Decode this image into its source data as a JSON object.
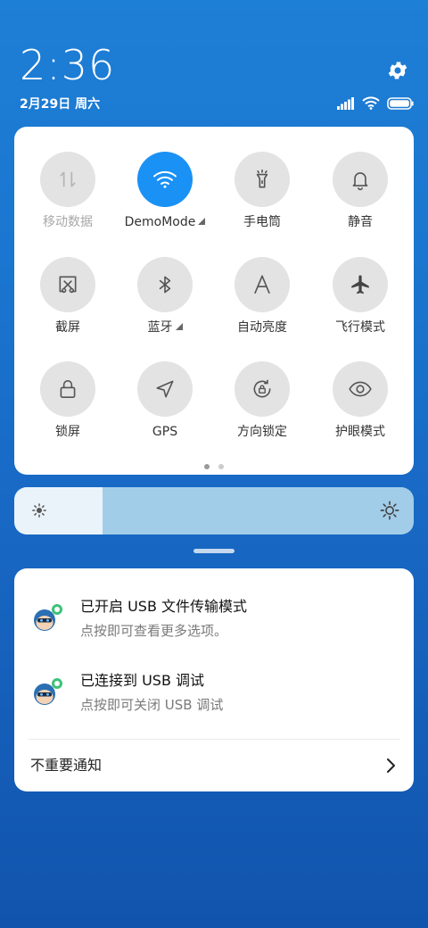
{
  "status_bar": {
    "time": "2:36",
    "date": "2月29日 周六",
    "icons": [
      "signal-icon",
      "wifi-icon",
      "battery-icon"
    ]
  },
  "quick_settings": {
    "tiles": [
      {
        "label": "移动数据",
        "icon": "mobile-data-icon",
        "active": false,
        "disabled": true
      },
      {
        "label": "DemoMode",
        "icon": "wifi-icon",
        "active": true,
        "disabled": false,
        "has_submenu": true
      },
      {
        "label": "手电筒",
        "icon": "flashlight-icon",
        "active": false,
        "disabled": false
      },
      {
        "label": "静音",
        "icon": "bell-icon",
        "active": false,
        "disabled": false
      },
      {
        "label": "截屏",
        "icon": "screenshot-icon",
        "active": false,
        "disabled": false
      },
      {
        "label": "蓝牙",
        "icon": "bluetooth-icon",
        "active": false,
        "disabled": false,
        "has_submenu": true
      },
      {
        "label": "自动亮度",
        "icon": "auto-brightness-icon",
        "active": false,
        "disabled": false
      },
      {
        "label": "飞行模式",
        "icon": "airplane-icon",
        "active": false,
        "disabled": false
      },
      {
        "label": "锁屏",
        "icon": "lock-icon",
        "active": false,
        "disabled": false
      },
      {
        "label": "GPS",
        "icon": "location-icon",
        "active": false,
        "disabled": false
      },
      {
        "label": "方向锁定",
        "icon": "rotation-lock-icon",
        "active": false,
        "disabled": false
      },
      {
        "label": "护眼模式",
        "icon": "eye-icon",
        "active": false,
        "disabled": false
      }
    ],
    "page_indicator": {
      "pages": 2,
      "current": 1
    }
  },
  "brightness": {
    "level": 0.22
  },
  "notifications": [
    {
      "title": "已开启 USB 文件传输模式",
      "subtitle": "点按即可查看更多选项。",
      "icon": "app-avatar-icon"
    },
    {
      "title": "已连接到 USB 调试",
      "subtitle": "点按即可关闭 USB 调试",
      "icon": "app-avatar-icon"
    }
  ],
  "unimportant_label": "不重要通知",
  "colors": {
    "accent": "#1a91f5",
    "tile_bg": "#e3e3e3",
    "brightness_fill": "#a2cde9"
  }
}
